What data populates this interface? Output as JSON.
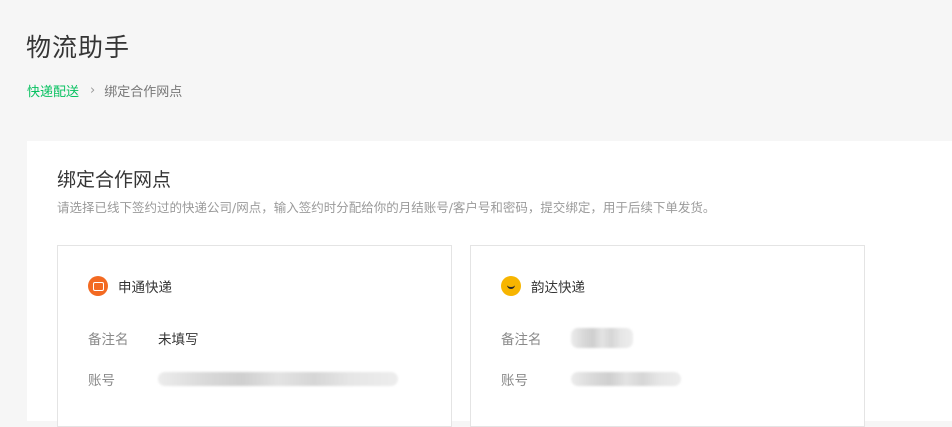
{
  "page": {
    "title": "物流助手"
  },
  "breadcrumb": {
    "parent": "快递配送",
    "separator": "›",
    "current": "绑定合作网点"
  },
  "panel": {
    "title": "绑定合作网点",
    "description": "请选择已线下签约过的快递公司/网点，输入签约时分配给你的月结账号/客户号和密码，提交绑定，用于后续下单发货。"
  },
  "cards": [
    {
      "company": "申通快递",
      "logo_icon": "sto-logo-icon",
      "logo_color": "#f36a22",
      "remark_label": "备注名",
      "remark_value": "未填写",
      "account_label": "账号"
    },
    {
      "company": "韵达快递",
      "logo_icon": "yunda-logo-icon",
      "logo_color": "#f7b500",
      "remark_label": "备注名",
      "account_label": "账号"
    }
  ],
  "colors": {
    "accent": "#07c160",
    "background": "#f6f6f6"
  }
}
